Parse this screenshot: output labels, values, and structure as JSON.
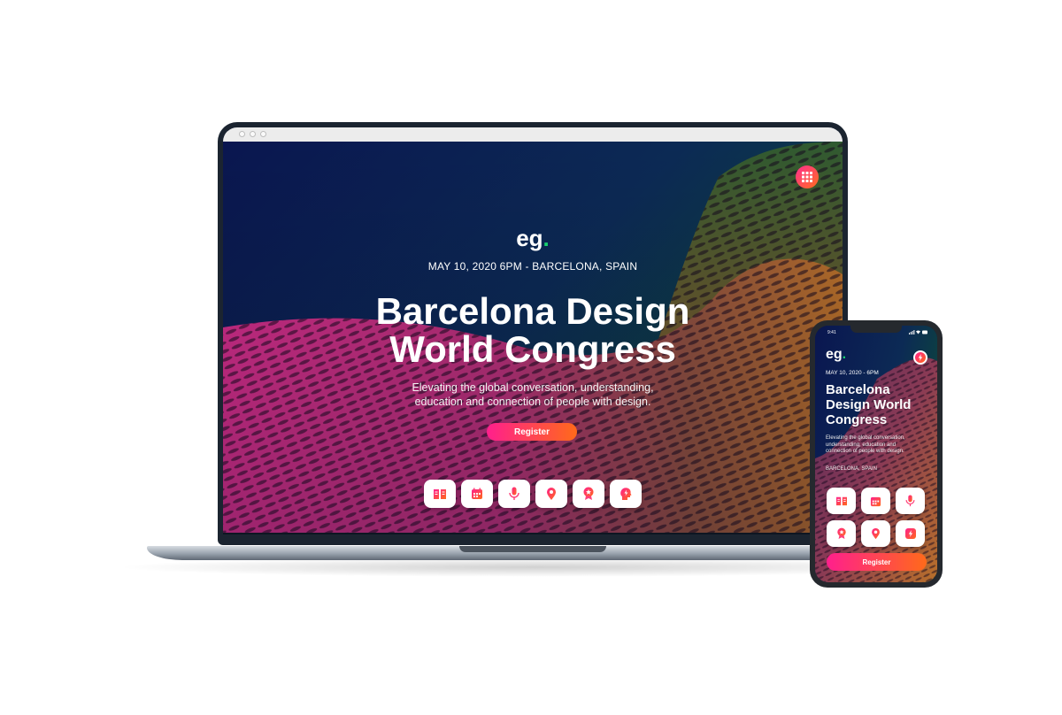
{
  "laptop": {
    "browser_dots": 3,
    "site": {
      "logo_text": "eg",
      "logo_dot": ".",
      "event_meta": "MAY 10, 2020 6PM - BARCELONA, SPAIN",
      "title_line1": "Barcelona Design",
      "title_line2": "World Congress",
      "subtitle_line1": "Elevating the global conversation, understanding,",
      "subtitle_line2": "education and connection of people with design.",
      "register_label": "Register",
      "apps_icon": "grid-icon",
      "icons": [
        "book-icon",
        "calendar-icon",
        "microphone-icon",
        "location-pin-icon",
        "badge-star-icon",
        "head-lightning-icon"
      ]
    }
  },
  "phone": {
    "status_time": "9:41",
    "logo_text": "eg",
    "logo_dot": ".",
    "event_date": "MAY 10, 2020 - 6PM",
    "title_line1": "Barcelona",
    "title_line2": "Design World",
    "title_line3": "Congress",
    "subtitle_line1": "Elevating the global conversation,",
    "subtitle_line2": "understanding, education and",
    "subtitle_line3": "connection of people with design.",
    "location": "BARCELONA, SPAIN",
    "register_label": "Register",
    "menu_icon": "lightning-icon",
    "icons": [
      "book-icon",
      "calendar-icon",
      "microphone-icon",
      "badge-star-icon",
      "location-pin-icon",
      "lightning-icon"
    ]
  },
  "colors": {
    "accent_start": "#ff1f8d",
    "accent_end": "#ff6a1a",
    "logo_dot": "#18d26e",
    "bg_navy": "#0a1440",
    "bg_green": "#0d4a3a",
    "bg_magenta": "#c0246e",
    "bg_orange": "#b8702a"
  }
}
